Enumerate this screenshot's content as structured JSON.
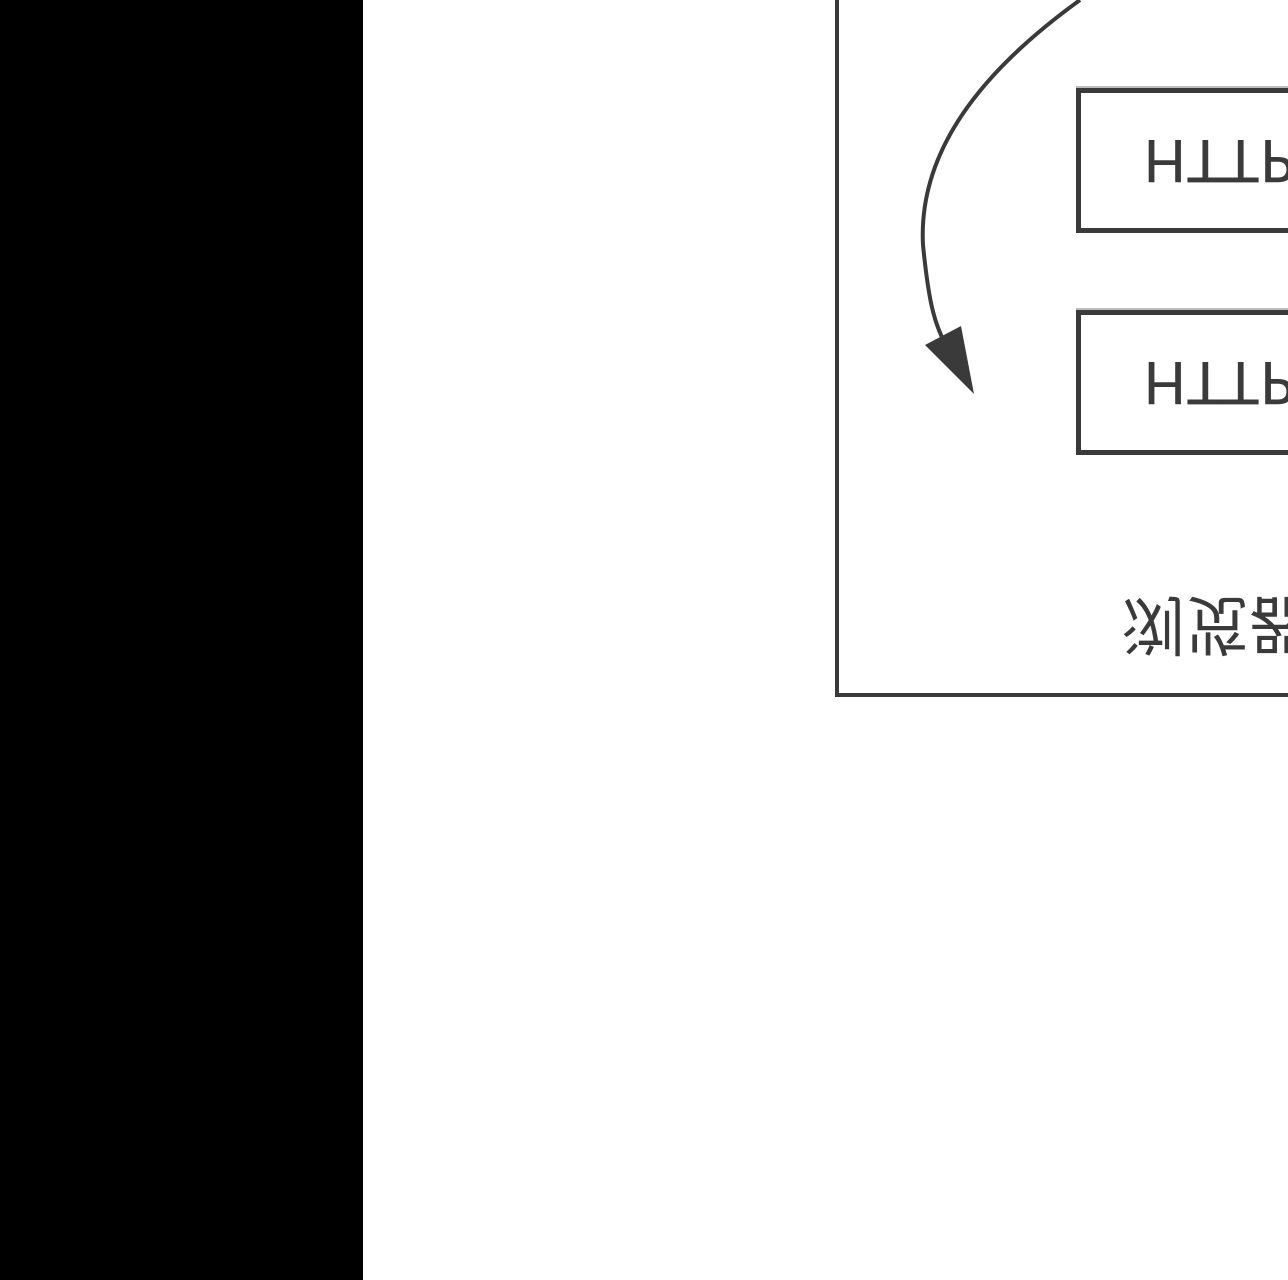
{
  "diagram": {
    "nodes": [
      {
        "label": "HTTP"
      },
      {
        "label": "HTTP"
      }
    ],
    "container_label": "浏览器",
    "colors": {
      "stroke": "#3a3a3a",
      "background": "#ffffff",
      "side_bar": "#000000"
    }
  }
}
